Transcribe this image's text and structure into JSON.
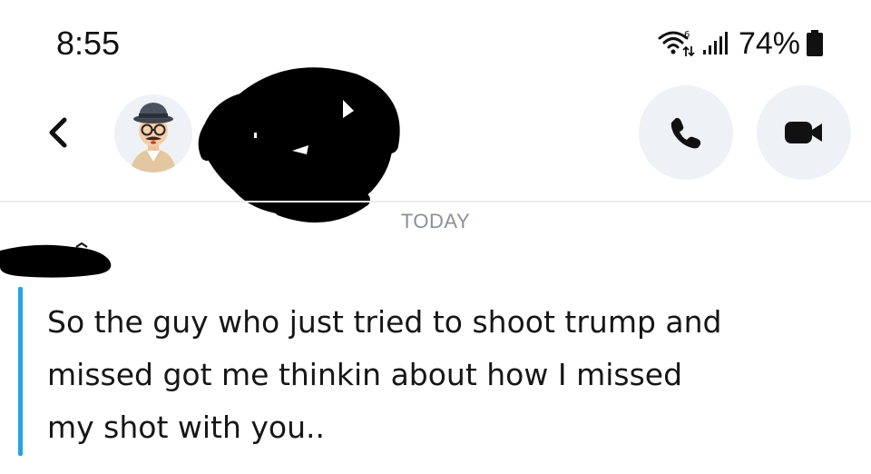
{
  "status_bar": {
    "time": "8:55",
    "battery_percent": "74%",
    "icons": [
      "wifi-icon",
      "signal-icon",
      "battery-icon"
    ]
  },
  "header": {
    "back_icon": "chevron-left-icon",
    "avatar_icon": "detective-avatar",
    "call_icon": "phone-icon",
    "video_icon": "video-camera-icon"
  },
  "chat": {
    "day_label": "TODAY",
    "message": "So the guy who just tried to shoot trump and\nmissed got me thinkin about how I missed\nmy shot with you.."
  },
  "colors": {
    "accent_bar": "#2aa1e0",
    "button_bg": "#eef1f5",
    "day_label": "#8a8f98",
    "redaction": "#000000"
  }
}
